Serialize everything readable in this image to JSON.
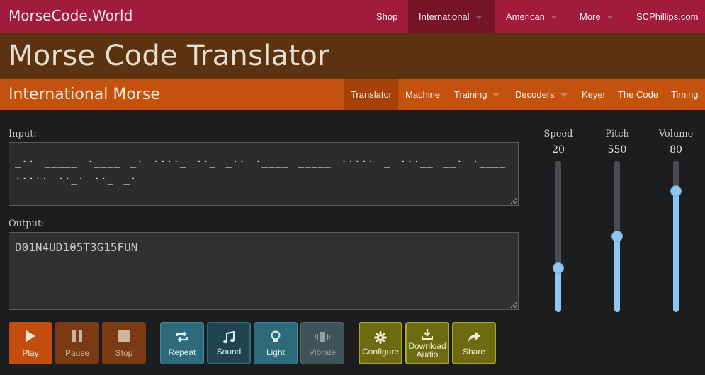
{
  "app": {
    "brand": "MorseCode.World",
    "page_title": "Morse Code Translator",
    "section_title": "International Morse"
  },
  "topnav": {
    "items": [
      {
        "label": "Shop"
      },
      {
        "label": "International",
        "dropdown": true,
        "active": true
      },
      {
        "label": "American",
        "dropdown": true
      },
      {
        "label": "More",
        "dropdown": true
      },
      {
        "label": "SCPhillips.com"
      }
    ]
  },
  "subnav": {
    "items": [
      {
        "label": "Translator",
        "active": true
      },
      {
        "label": "Machine"
      },
      {
        "label": "Training",
        "dropdown": true
      },
      {
        "label": "Decoders",
        "dropdown": true
      },
      {
        "label": "Keyer"
      },
      {
        "label": "The Code"
      },
      {
        "label": "Timing"
      }
    ]
  },
  "input": {
    "label": "Input:",
    "value": "_·· _____ ·____ _· ····_ ··_ _·· ·____ _____ ····· _ ···__ __· ·____ ····· ··_· ··_ _·"
  },
  "output": {
    "label": "Output:",
    "value": "D01N4UD105T3G15FUN"
  },
  "sliders": [
    {
      "name": "speed",
      "label": "Speed",
      "value": "20",
      "level": 0.29
    },
    {
      "name": "pitch",
      "label": "Pitch",
      "value": "550",
      "level": 0.5
    },
    {
      "name": "volume",
      "label": "Volume",
      "value": "80",
      "level": 0.8
    }
  ],
  "buttons": {
    "play": "Play",
    "pause": "Pause",
    "stop": "Stop",
    "repeat": "Repeat",
    "sound": "Sound",
    "light": "Light",
    "vibrate": "Vibrate",
    "configure": "Configure",
    "download_line1": "Download",
    "download_line2": "Audio",
    "share": "Share"
  },
  "colors": {
    "topnav": "#a01c3a",
    "title_band": "#5b3310",
    "subnav": "#c4520f",
    "slider": "#8fc6f2"
  },
  "icons": {
    "play": "play-icon",
    "pause": "pause-icon",
    "stop": "stop-icon",
    "repeat": "repeat-icon",
    "sound": "music-note-icon",
    "light": "lightbulb-icon",
    "vibrate": "vibrate-icon",
    "configure": "gear-icon",
    "download": "download-icon",
    "share": "share-icon"
  }
}
